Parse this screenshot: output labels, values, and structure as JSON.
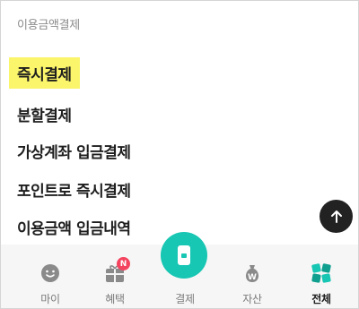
{
  "section": {
    "title": "이용금액결제"
  },
  "menu": {
    "items": [
      {
        "label": "즉시결제",
        "highlighted": true
      },
      {
        "label": "분할결제"
      },
      {
        "label": "가상계좌 입금결제"
      },
      {
        "label": "포인트로 즉시결제"
      },
      {
        "label": "이용금액 입금내역"
      }
    ]
  },
  "scroll_top": {
    "icon": "arrow-up-icon"
  },
  "bottom_nav": {
    "items": [
      {
        "label": "마이",
        "icon": "smile-icon"
      },
      {
        "label": "혜택",
        "icon": "gift-icon",
        "badge": "N"
      },
      {
        "label": "결제",
        "icon": "card-icon"
      },
      {
        "label": "자산",
        "icon": "money-bag-icon"
      },
      {
        "label": "전체",
        "icon": "grid-icon",
        "active": true
      }
    ]
  },
  "colors": {
    "highlight": "#fbf56b",
    "accent": "#17c6b3",
    "badge": "#f4435e"
  }
}
